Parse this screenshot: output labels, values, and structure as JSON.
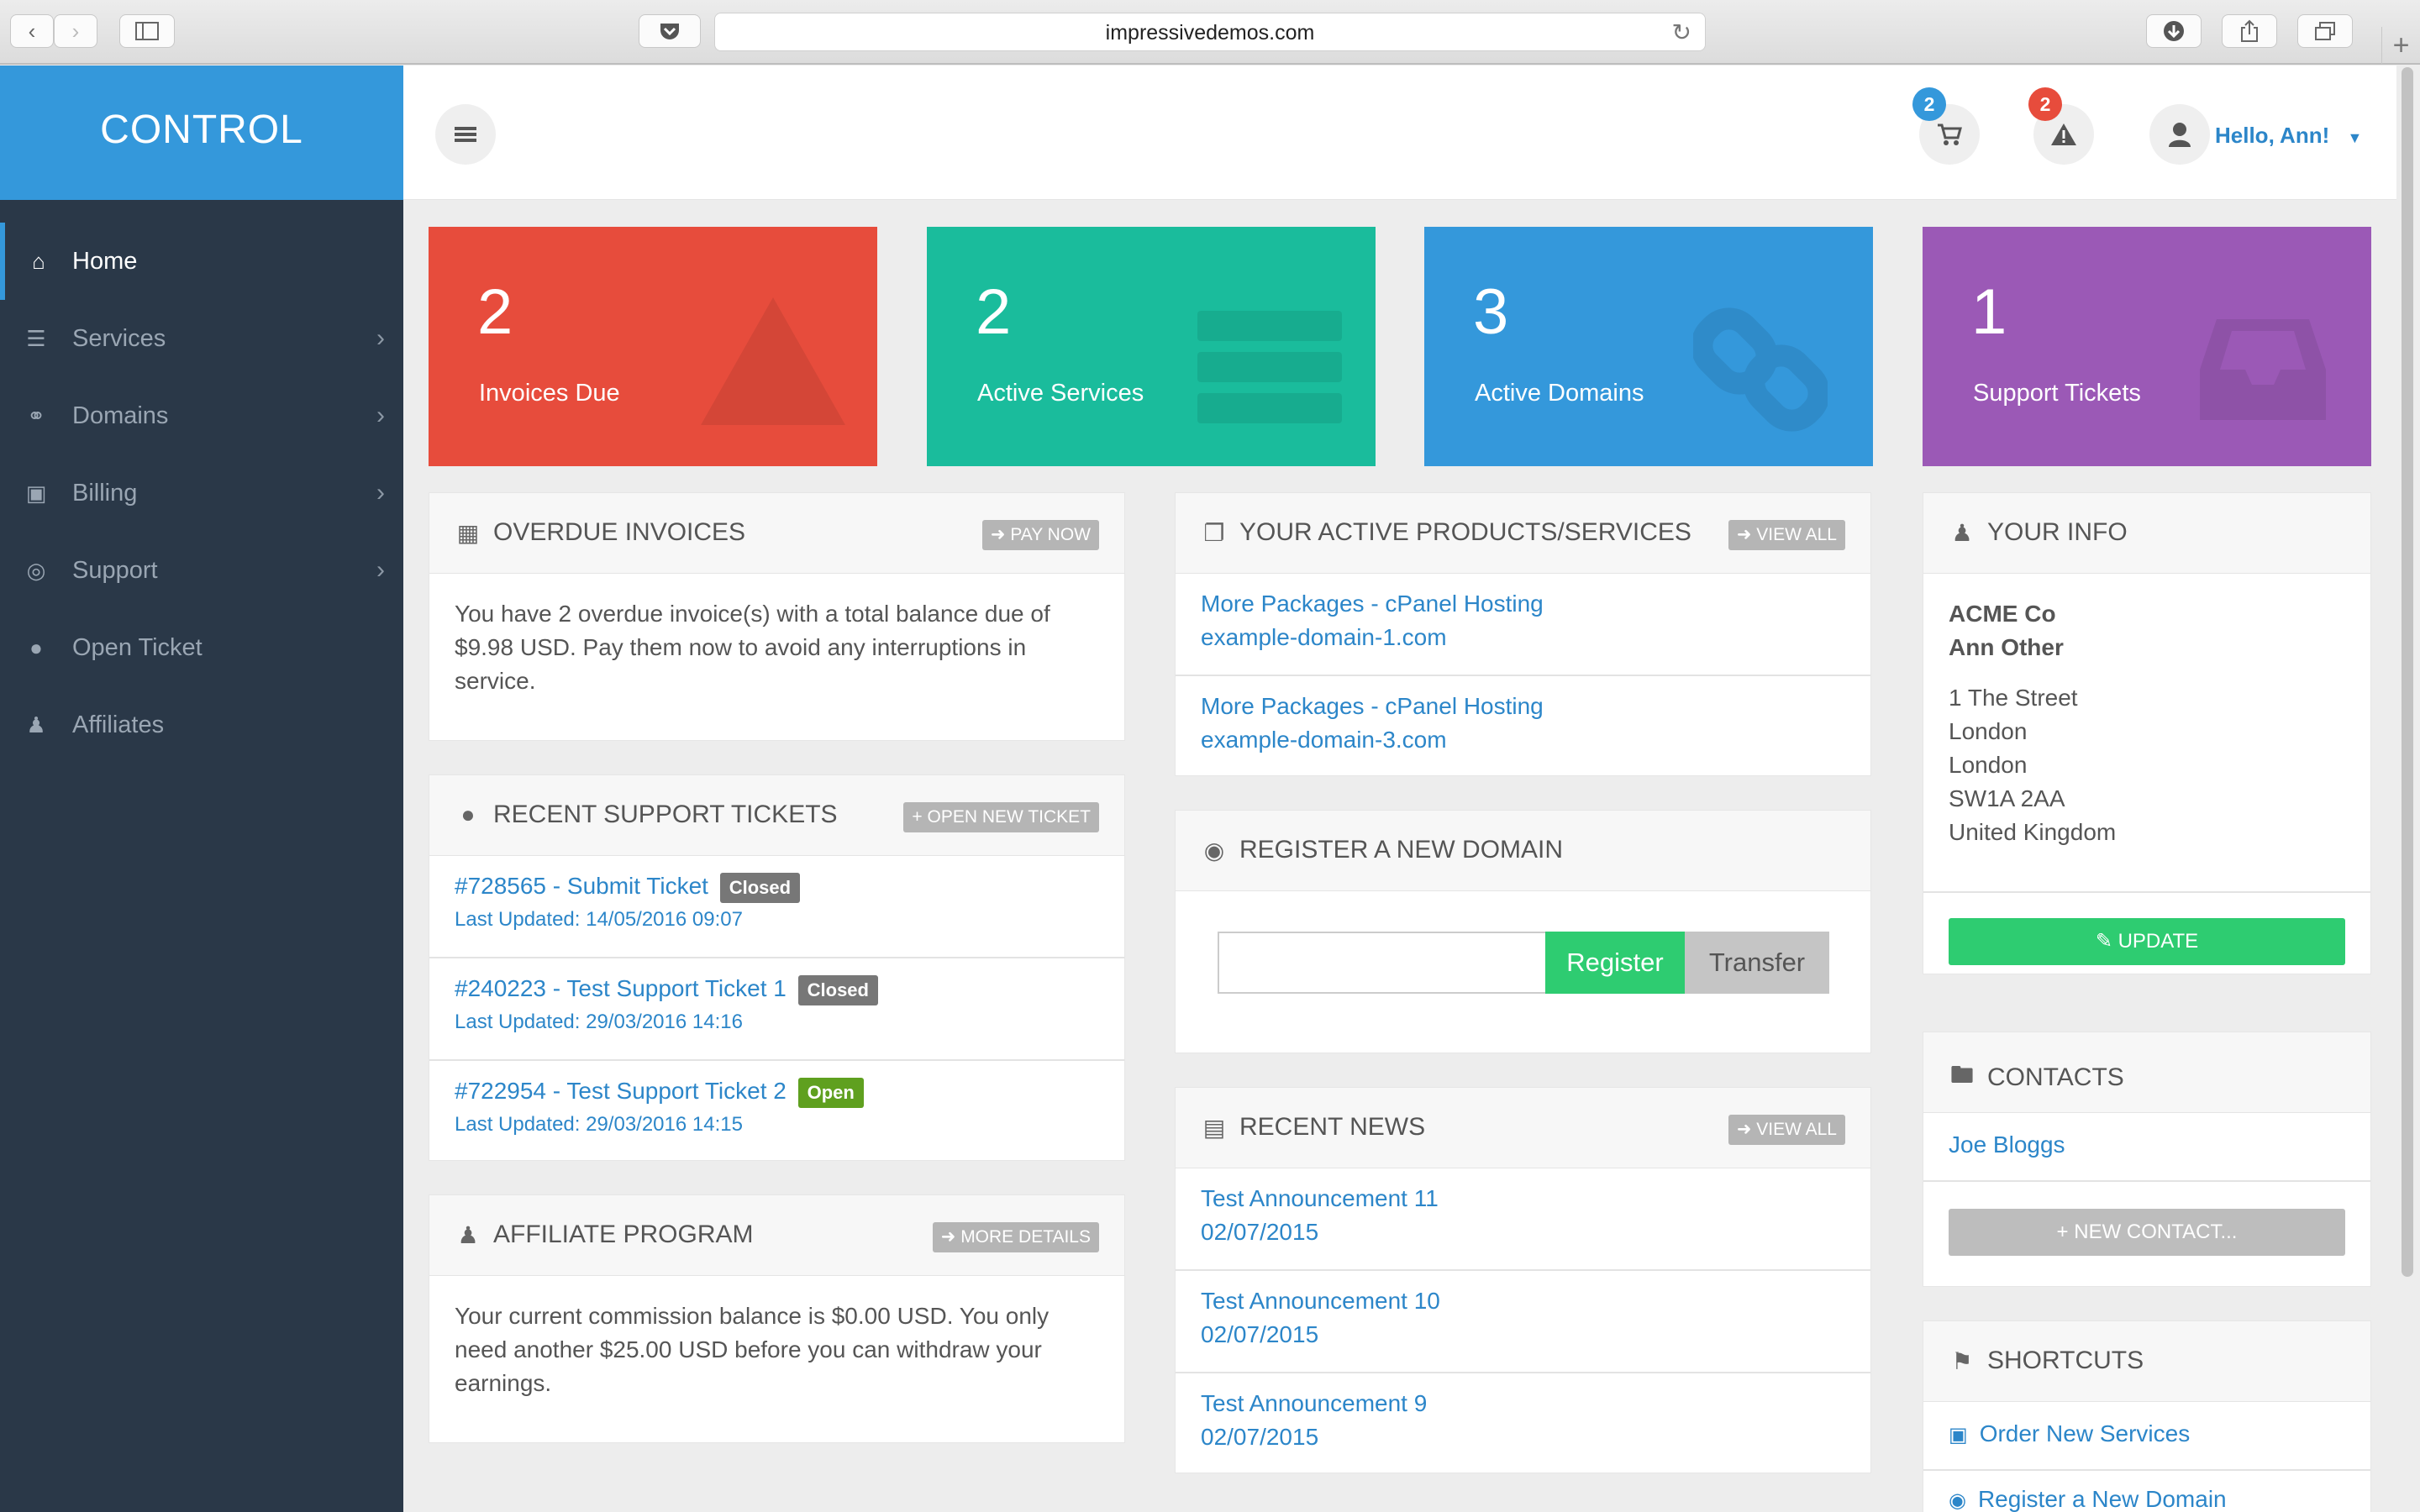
{
  "browser": {
    "url": "impressivedemos.com"
  },
  "sidebar": {
    "brand": "CONTROL",
    "items": [
      {
        "label": "Home",
        "icon": "home-icon",
        "has_children": false
      },
      {
        "label": "Services",
        "icon": "services-icon",
        "has_children": true
      },
      {
        "label": "Domains",
        "icon": "link-icon",
        "has_children": true
      },
      {
        "label": "Billing",
        "icon": "money-icon",
        "has_children": true
      },
      {
        "label": "Support",
        "icon": "lifebuoy-icon",
        "has_children": true
      },
      {
        "label": "Open Ticket",
        "icon": "comment-icon",
        "has_children": false
      },
      {
        "label": "Affiliates",
        "icon": "users-icon",
        "has_children": false
      }
    ]
  },
  "header": {
    "cart_count": "2",
    "alerts_count": "2",
    "greeting": "Hello, Ann!"
  },
  "tiles": [
    {
      "count": "2",
      "label": "Invoices Due",
      "color": "#e74c3c"
    },
    {
      "count": "2",
      "label": "Active Services",
      "color": "#1abc9c"
    },
    {
      "count": "3",
      "label": "Active Domains",
      "color": "#3498db"
    },
    {
      "count": "1",
      "label": "Support Tickets",
      "color": "#9b59b6"
    }
  ],
  "overdue": {
    "title": "OVERDUE INVOICES",
    "button": "PAY NOW",
    "text": "You have 2 overdue invoice(s) with a total balance due of $9.98 USD. Pay them now to avoid any interruptions in service."
  },
  "tickets": {
    "title": "RECENT SUPPORT TICKETS",
    "button": "OPEN NEW TICKET",
    "items": [
      {
        "title": "#728565 - Submit Ticket",
        "status": "Closed",
        "updated": "Last Updated: 14/05/2016 09:07"
      },
      {
        "title": "#240223 - Test Support Ticket 1",
        "status": "Closed",
        "updated": "Last Updated: 29/03/2016 14:16"
      },
      {
        "title": "#722954 - Test Support Ticket 2",
        "status": "Open",
        "updated": "Last Updated: 29/03/2016 14:15"
      }
    ]
  },
  "affiliate": {
    "title": "AFFILIATE PROGRAM",
    "button": "MORE DETAILS",
    "text": "Your current commission balance is $0.00 USD. You only need another $25.00 USD before you can withdraw your earnings."
  },
  "products": {
    "title": "YOUR ACTIVE PRODUCTS/SERVICES",
    "button": "VIEW ALL",
    "items": [
      {
        "name": "More Packages - cPanel Hosting",
        "domain": "example-domain-1.com"
      },
      {
        "name": "More Packages - cPanel Hosting",
        "domain": "example-domain-3.com"
      }
    ]
  },
  "register": {
    "title": "REGISTER A NEW DOMAIN",
    "input_value": "",
    "register_label": "Register",
    "transfer_label": "Transfer"
  },
  "news": {
    "title": "RECENT NEWS",
    "button": "VIEW ALL",
    "items": [
      {
        "title": "Test Announcement 11",
        "date": "02/07/2015"
      },
      {
        "title": "Test Announcement 10",
        "date": "02/07/2015"
      },
      {
        "title": "Test Announcement 9",
        "date": "02/07/2015"
      }
    ]
  },
  "info": {
    "title": "YOUR INFO",
    "company": "ACME Co",
    "name": "Ann Other",
    "address": [
      "1 The Street",
      "London",
      "London",
      "SW1A 2AA",
      "United Kingdom"
    ],
    "button": "UPDATE"
  },
  "contacts": {
    "title": "CONTACTS",
    "items": [
      "Joe Bloggs"
    ],
    "button": "NEW CONTACT..."
  },
  "shortcuts": {
    "title": "SHORTCUTS",
    "items": [
      {
        "label": "Order New Services",
        "icon": "cart-icon"
      },
      {
        "label": "Register a New Domain",
        "icon": "globe-icon"
      }
    ]
  },
  "colors": {
    "brand": "#3498db",
    "sidebar": "#2a3848",
    "link": "#2c86c9",
    "success": "#2ecc71"
  }
}
